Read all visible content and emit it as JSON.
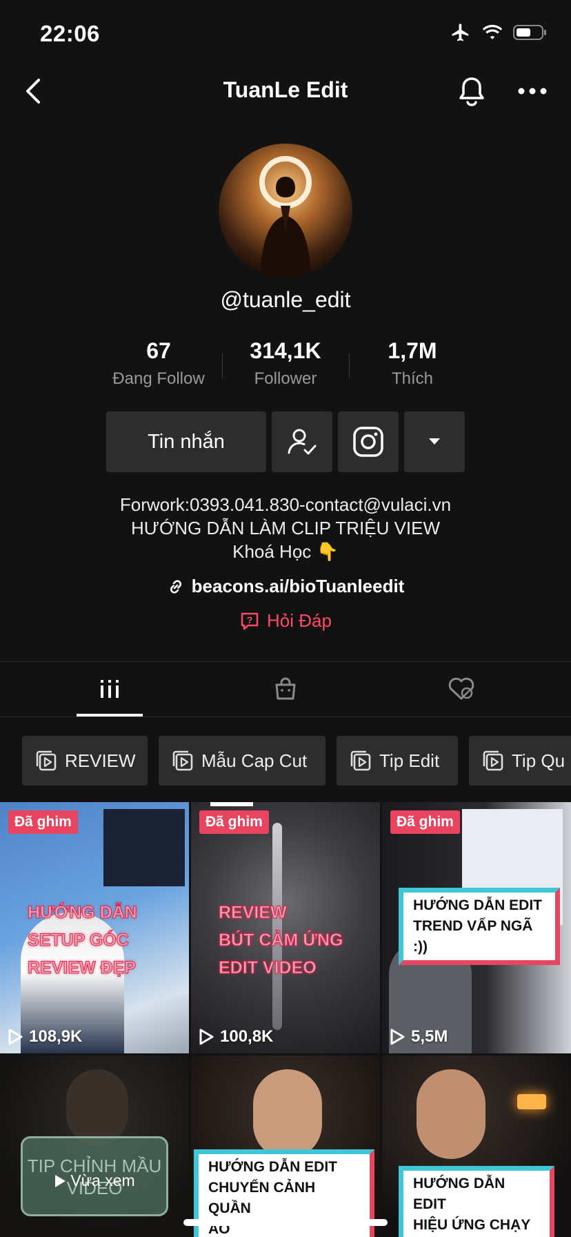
{
  "status": {
    "time": "22:06"
  },
  "nav": {
    "title": "TuanLe Edit"
  },
  "profile": {
    "handle": "@tuanle_edit"
  },
  "stats": [
    {
      "value": "67",
      "label": "Đang Follow"
    },
    {
      "value": "314,1K",
      "label": "Follower"
    },
    {
      "value": "1,7M",
      "label": "Thích"
    }
  ],
  "actions": {
    "message_label": "Tin nhắn"
  },
  "bio": {
    "line1": "Forwork:0393.041.830-contact@vulaci.vn",
    "line2": "HƯỚNG DẪN LÀM CLIP TRIỆU VIEW",
    "line3": "Khoá Học 👇",
    "link": "beacons.ai/bioTuanleedit",
    "qa": "Hỏi Đáp"
  },
  "playlists": [
    "REVIEW",
    "Mẫu Cap Cut",
    "Tip Edit",
    "Tip Qu"
  ],
  "videos": [
    {
      "pinned": "Đã ghim",
      "views": "108,9K",
      "overlay": [
        "HƯỚNG DẪN",
        "SETUP GÓC",
        "REVIEW ĐẸP"
      ]
    },
    {
      "pinned": "Đã ghim",
      "views": "100,8K",
      "overlay": [
        "REVIEW",
        "BÚT CẢM ỨNG",
        "EDIT VIDEO"
      ]
    },
    {
      "pinned": "Đã ghim",
      "views": "5,5M",
      "overlay": [
        "HƯỚNG DẪN EDIT",
        "TREND VẤP NGÃ :))"
      ]
    },
    {
      "overlay": [
        "TIP CHỈNH MẦU",
        "VIDEO"
      ],
      "recent_label": "Vừa xem"
    },
    {
      "overlay": [
        "HƯỚNG DẪN EDIT",
        "CHUYỂN CẢNH QUẦN",
        "ÁO"
      ]
    },
    {
      "overlay": [
        "HƯỚNG DẪN EDIT",
        "HIỆU ỨNG CHẠY"
      ]
    }
  ],
  "colors": {
    "background": "#121212",
    "button": "#2d2d2d",
    "accent_red": "#ff4a67",
    "pin": "#e9445f"
  }
}
